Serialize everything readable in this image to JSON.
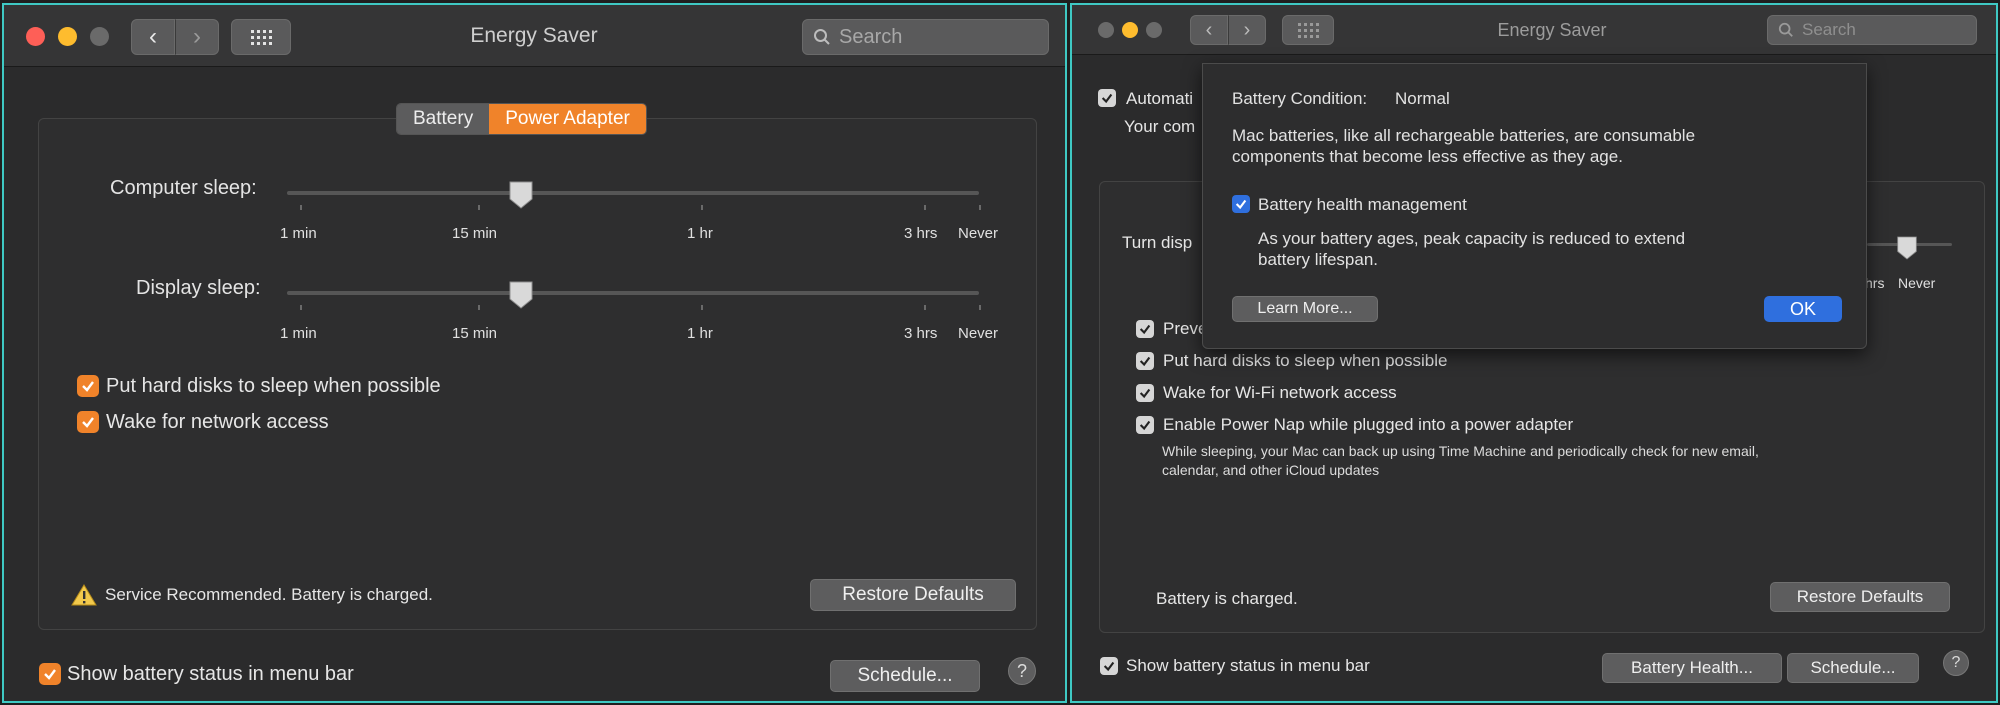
{
  "left": {
    "title": "Energy Saver",
    "search_placeholder": "Search",
    "tabs": [
      {
        "label": "Battery",
        "selected": false
      },
      {
        "label": "Power Adapter",
        "selected": true
      }
    ],
    "sliders": [
      {
        "label": "Computer sleep:",
        "value": "15 min"
      },
      {
        "label": "Display sleep:",
        "value": "15 min"
      }
    ],
    "tick_labels": [
      "1 min",
      "15 min",
      "1 hr",
      "3 hrs",
      "Never"
    ],
    "checkboxes": [
      {
        "label": "Put hard disks to sleep when possible",
        "checked": true
      },
      {
        "label": "Wake for network access",
        "checked": true
      }
    ],
    "status": "Service Recommended. Battery is charged.",
    "restore_defaults": "Restore Defaults",
    "show_battery": "Show battery status in menu bar",
    "schedule": "Schedule...",
    "help": "?",
    "accent_color": "#f0832a"
  },
  "right": {
    "title": "Energy Saver",
    "search_placeholder": "Search",
    "partial_auto": "Automati",
    "partial_your": "Your com",
    "partial_turn": "Turn disp",
    "partial_hrs": "hrs",
    "never": "Never",
    "partial_prevent": "Preve",
    "checkboxes": [
      {
        "label": "Put hard disks to sleep when possible",
        "checked": true
      },
      {
        "label": "Wake for Wi-Fi network access",
        "checked": true
      },
      {
        "label": "Enable Power Nap while plugged into a power adapter",
        "checked": true
      }
    ],
    "power_nap_desc_1": "While sleeping, your Mac can back up using Time Machine and periodically check for new email,",
    "power_nap_desc_2": "calendar, and other iCloud updates",
    "status": "Battery is charged.",
    "restore_defaults": "Restore Defaults",
    "show_battery": "Show battery status in menu bar",
    "battery_health": "Battery Health...",
    "schedule": "Schedule...",
    "help": "?",
    "sheet": {
      "condition_label": "Battery Condition:",
      "condition_value": "Normal",
      "desc_1": "Mac batteries, like all rechargeable batteries, are consumable",
      "desc_2": "components that become less effective as they age.",
      "health_mgmt_label": "Battery health management",
      "health_mgmt_checked": true,
      "health_desc_1": "As your battery ages, peak capacity is reduced to extend",
      "health_desc_2": "battery lifespan.",
      "learn_more": "Learn More...",
      "ok": "OK"
    }
  }
}
